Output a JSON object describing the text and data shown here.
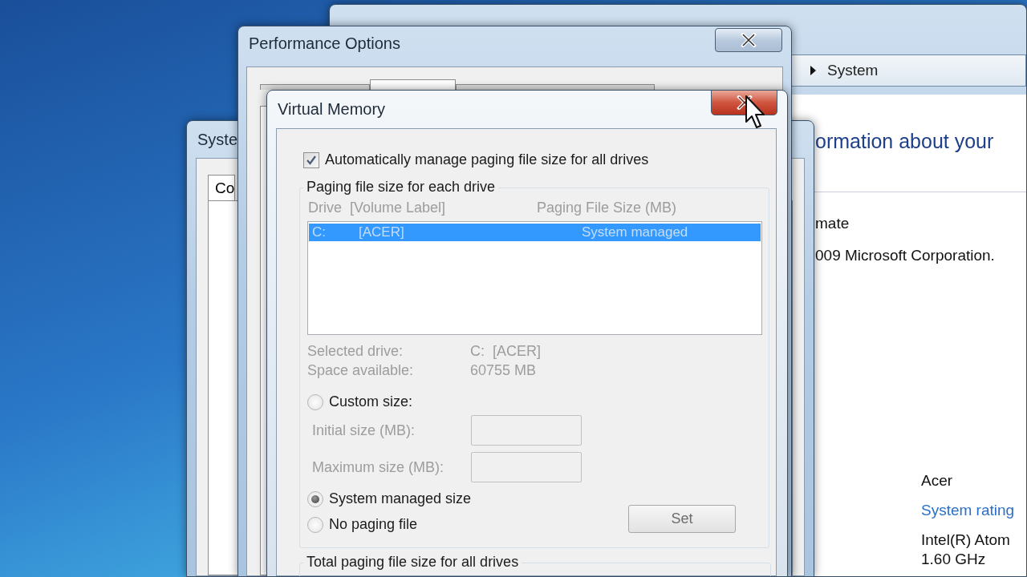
{
  "control_panel": {
    "breadcrumb": [
      "System"
    ],
    "heading": "ormation about your",
    "edition_lines": [
      "mate",
      "009 Microsoft Corporation."
    ],
    "system_values": [
      {
        "kind": "text",
        "text": "Acer"
      },
      {
        "kind": "link",
        "text": "System rating"
      },
      {
        "kind": "text",
        "text": "Intel(R) Atom"
      },
      {
        "kind": "text",
        "text": "1.60 GHz"
      }
    ]
  },
  "system_properties": {
    "title": "Syste",
    "tabs": [
      {
        "label": "Co",
        "selected": true
      }
    ]
  },
  "performance_options": {
    "title": "Performance Options",
    "tabs": [
      {
        "selected": false
      },
      {
        "selected": true
      },
      {
        "selected": false
      }
    ]
  },
  "virtual_memory": {
    "title": "Virtual Memory",
    "auto_manage": {
      "label": "Automatically manage paging file size for all drives",
      "checked": true
    },
    "per_drive": {
      "title": "Paging file size for each drive",
      "disabled": true,
      "columns": [
        "Drive  [Volume Label]",
        "Paging File Size (MB)"
      ],
      "rows": [
        {
          "drive": "C:",
          "volume": "[ACER]",
          "size": "System managed",
          "selected": true
        }
      ],
      "info": [
        {
          "label": "Selected drive:",
          "value": "C:  [ACER]"
        },
        {
          "label": "Space available:",
          "value": "60755 MB"
        }
      ],
      "custom_option": {
        "label": "Custom size:",
        "selected": false
      },
      "size_fields": [
        {
          "label": "Initial size (MB):"
        },
        {
          "label": "Maximum size (MB):"
        }
      ],
      "other_options": [
        {
          "label": "System managed size",
          "selected": true
        },
        {
          "label": "No paging file",
          "selected": false
        }
      ],
      "set_button": "Set"
    },
    "total": {
      "title": "Total paging file size for all drives"
    }
  }
}
